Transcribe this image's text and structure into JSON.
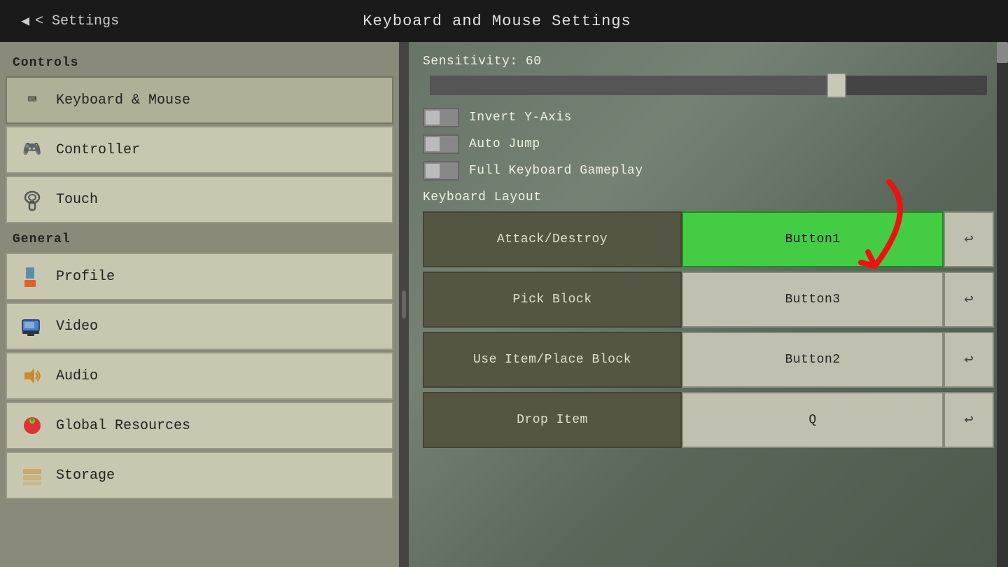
{
  "header": {
    "back_label": "< Settings",
    "title": "Keyboard and Mouse Settings"
  },
  "sidebar": {
    "controls_title": "Controls",
    "general_title": "General",
    "items": [
      {
        "id": "keyboard-mouse",
        "label": "Keyboard & Mouse",
        "icon": "⌨",
        "section": "controls",
        "active": true
      },
      {
        "id": "controller",
        "label": "Controller",
        "icon": "🎮",
        "section": "controls",
        "active": false
      },
      {
        "id": "touch",
        "label": "Touch",
        "icon": "✋",
        "section": "controls",
        "active": false
      },
      {
        "id": "profile",
        "label": "Profile",
        "icon": "🧱",
        "section": "general",
        "active": false
      },
      {
        "id": "video",
        "label": "Video",
        "icon": "🖥",
        "section": "general",
        "active": false
      },
      {
        "id": "audio",
        "label": "Audio",
        "icon": "🔊",
        "section": "general",
        "active": false
      },
      {
        "id": "global-resources",
        "label": "Global Resources",
        "icon": "🍓",
        "section": "general",
        "active": false
      },
      {
        "id": "storage",
        "label": "Storage",
        "icon": "📁",
        "section": "general",
        "active": false
      }
    ]
  },
  "right_panel": {
    "sensitivity_label": "Sensitivity: 60",
    "sensitivity_value": 60,
    "toggles": [
      {
        "id": "invert-y",
        "label": "Invert Y-Axis",
        "enabled": false
      },
      {
        "id": "auto-jump",
        "label": "Auto Jump",
        "enabled": false
      },
      {
        "id": "full-keyboard",
        "label": "Full Keyboard Gameplay",
        "enabled": false
      }
    ],
    "keyboard_layout_title": "Keyboard Layout",
    "keybindings": [
      {
        "id": "attack-destroy",
        "action": "Attack/Destroy",
        "key": "Button1",
        "active": true
      },
      {
        "id": "pick-block",
        "action": "Pick Block",
        "key": "Button3",
        "active": false
      },
      {
        "id": "use-item",
        "action": "Use Item/Place Block",
        "key": "Button2",
        "active": false
      },
      {
        "id": "drop-item",
        "action": "Drop Item",
        "key": "Q",
        "active": false
      }
    ],
    "reset_icon": "↩"
  }
}
